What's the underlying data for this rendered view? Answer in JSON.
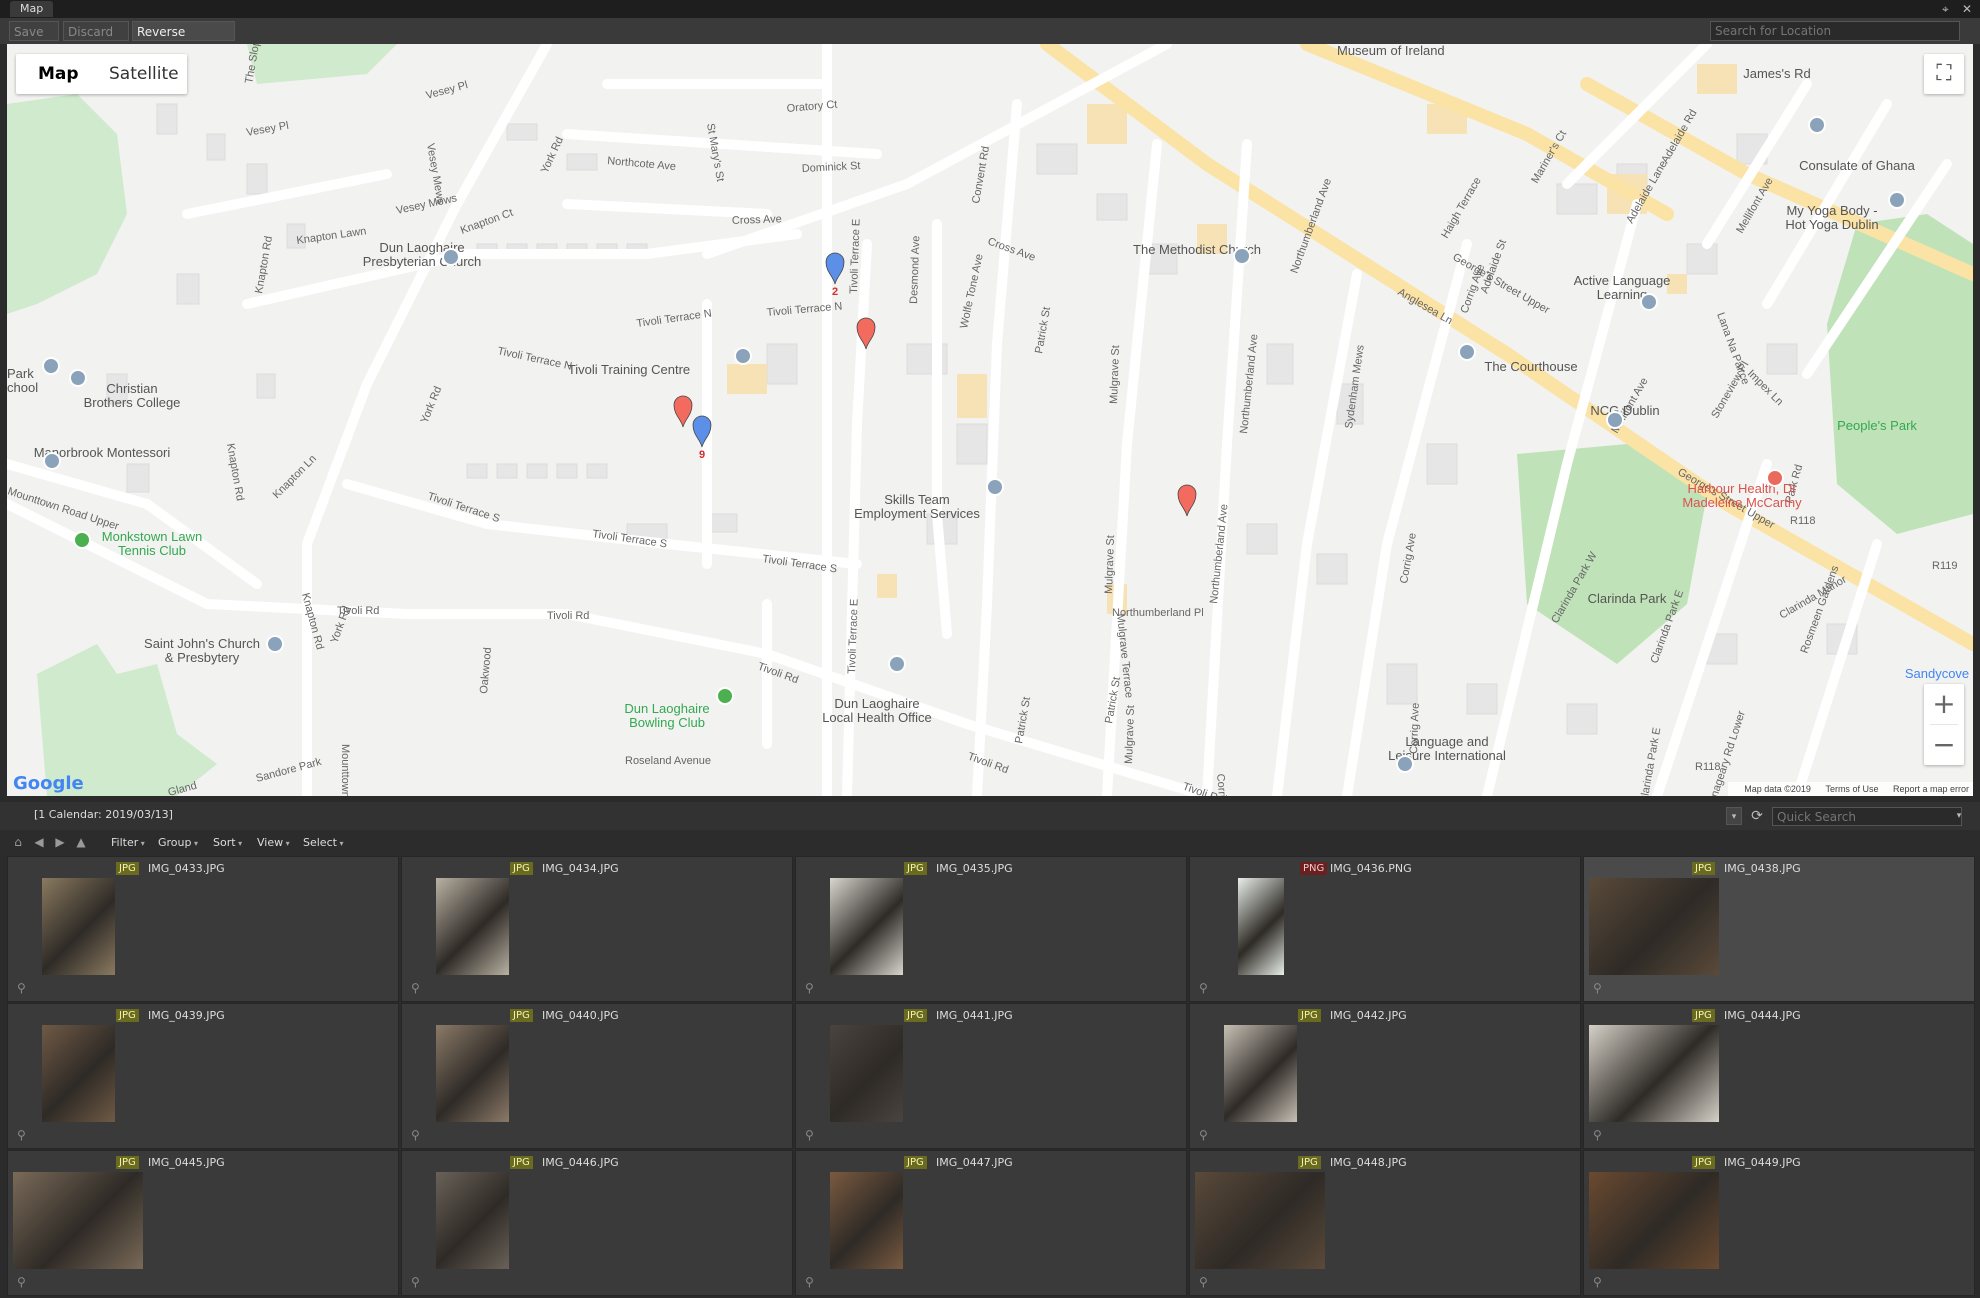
{
  "window": {
    "title": "Map",
    "pin_glyph": "⌖",
    "close_glyph": "✕"
  },
  "toolbar": {
    "save_all": "Save All",
    "discard_all": "Discard All",
    "reverse_geocode": "Reverse Geocode",
    "search_placeholder": "Search for Location"
  },
  "map": {
    "type_map": "Map",
    "type_satellite": "Satellite",
    "fullscreen_glyph": "⛶",
    "zoom_in": "+",
    "zoom_out": "−",
    "google_logo": "Google",
    "attribution": {
      "data": "Map data ©2019",
      "terms": "Terms of Use",
      "report": "Report a map error"
    },
    "labels": [
      {
        "text": "Vesey Pl"
      },
      {
        "text": "Vesey Pl"
      },
      {
        "text": "Vesey Mews"
      },
      {
        "text": "Vesey Mews"
      },
      {
        "text": "Knapton Lawn"
      },
      {
        "text": "Knapton Ct"
      },
      {
        "text": "Knapton Rd"
      },
      {
        "text": "Knapton Rd"
      },
      {
        "text": "Knapton Ln"
      },
      {
        "text": "Knapton Rd"
      },
      {
        "text": "York Rd"
      },
      {
        "text": "York Rd"
      },
      {
        "text": "York Rd"
      },
      {
        "text": "Northcote Ave"
      },
      {
        "text": "Dominick St"
      },
      {
        "text": "Oratory Ct"
      },
      {
        "text": "St Mary's St"
      },
      {
        "text": "Cross Ave"
      },
      {
        "text": "Cross Ave"
      },
      {
        "text": "Tivoli Terrace N"
      },
      {
        "text": "Tivoli Terrace N"
      },
      {
        "text": "Tivoli Terrace N"
      },
      {
        "text": "Tivoli Terrace E"
      },
      {
        "text": "Tivoli Terrace E"
      },
      {
        "text": "Tivoli Terrace S"
      },
      {
        "text": "Tivoli Terrace S"
      },
      {
        "text": "Tivoli Terrace S"
      },
      {
        "text": "Desmond Ave"
      },
      {
        "text": "Wolfe Tone Ave"
      },
      {
        "text": "Convent Rd"
      },
      {
        "text": "Patrick St"
      },
      {
        "text": "Patrick St"
      },
      {
        "text": "Patrick St"
      },
      {
        "text": "Mulgrave St"
      },
      {
        "text": "Mulgrave St"
      },
      {
        "text": "Mulgrave St"
      },
      {
        "text": "Mulgrave Terrace"
      },
      {
        "text": "Northumberland Ave"
      },
      {
        "text": "Northumberland Ave"
      },
      {
        "text": "Northumberland Ave"
      },
      {
        "text": "Northumberland Pl"
      },
      {
        "text": "Sydenham Mews"
      },
      {
        "text": "Anglesea Ln"
      },
      {
        "text": "Corrig Ave"
      },
      {
        "text": "Corrig Ave"
      },
      {
        "text": "Corrig Ave"
      },
      {
        "text": "Corrig Park"
      },
      {
        "text": "George's Street Upper"
      },
      {
        "text": "George's Street Upper"
      },
      {
        "text": "Haigh Terrace"
      },
      {
        "text": "Mariner's Ct"
      },
      {
        "text": "Adelaide St"
      },
      {
        "text": "Adelaide Lane"
      },
      {
        "text": "Adelaide Rd"
      },
      {
        "text": "Mellifont Ave"
      },
      {
        "text": "Mellifont Ave"
      },
      {
        "text": "Lana Na Pairce"
      },
      {
        "text": "Stoneview Pl"
      },
      {
        "text": "Impex Ln"
      },
      {
        "text": "Park Rd"
      },
      {
        "text": "Clarinda Park W"
      },
      {
        "text": "Clarinda Park E"
      },
      {
        "text": "Clarinda Park E"
      },
      {
        "text": "Clarinda Manor"
      },
      {
        "text": "Glenageary Rd Lower"
      },
      {
        "text": "Rosmeen Gardens"
      },
      {
        "text": "Tivoli Rd"
      },
      {
        "text": "Tivoli Rd"
      },
      {
        "text": "Tivoli Rd"
      },
      {
        "text": "Tivoli Rd"
      },
      {
        "text": "Tivoli Rd"
      },
      {
        "text": "Mounttown Lower"
      },
      {
        "text": "Mounttown Road Upper"
      },
      {
        "text": "Oakwood"
      },
      {
        "text": "Roseland Avenue"
      },
      {
        "text": "Gland"
      },
      {
        "text": "Sandore Park"
      },
      {
        "text": "The Slope"
      },
      {
        "text": "R118"
      },
      {
        "text": "R119"
      },
      {
        "text": "R118"
      }
    ],
    "pois": [
      {
        "name": "Dun Laoghaire Presbyterian Church"
      },
      {
        "name": "Tivoli Training Centre"
      },
      {
        "name": "Christian Brothers College"
      },
      {
        "name": "Park School"
      },
      {
        "name": "Manorbrook Montessori"
      },
      {
        "name": "Monkstown Lawn Tennis Club"
      },
      {
        "name": "Saint John's Church & Presbytery"
      },
      {
        "name": "Dun Laoghaire Bowling Club"
      },
      {
        "name": "Dun Laoghaire Local Health Office"
      },
      {
        "name": "Skills Team Employment Services"
      },
      {
        "name": "The Methodist Church"
      },
      {
        "name": "The Courthouse"
      },
      {
        "name": "Active Language Learning"
      },
      {
        "name": "Consulate of Ghana"
      },
      {
        "name": "My Yoga Body - Hot Yoga Dublin"
      },
      {
        "name": "NCG Dublin"
      },
      {
        "name": "People's Park"
      },
      {
        "name": "Harbour Health, Dr Madeleine McCarthy"
      },
      {
        "name": "Clarinda Park"
      },
      {
        "name": "Language and Leisure International"
      },
      {
        "name": "Sandycove"
      },
      {
        "name": "Museum of Ireland"
      },
      {
        "name": "James's Rd"
      }
    ],
    "markers": [
      {
        "color": "#5b8fe8",
        "label": "2"
      },
      {
        "color": "#f26b5e",
        "label": ""
      },
      {
        "color": "#f26b5e",
        "label": ""
      },
      {
        "color": "#5b8fe8",
        "label": "9"
      },
      {
        "color": "#f26b5e",
        "label": ""
      }
    ]
  },
  "calendar_bar": {
    "label": "[1 Calendar: 2019/03/13]",
    "quick_search_placeholder": "Quick Search"
  },
  "filter_bar": {
    "menus": [
      "Filter",
      "Group",
      "Sort",
      "View",
      "Select"
    ]
  },
  "thumbnails": [
    {
      "name": "IMG_0433.JPG",
      "type": "JPG",
      "selected": false
    },
    {
      "name": "IMG_0434.JPG",
      "type": "JPG",
      "selected": false
    },
    {
      "name": "IMG_0435.JPG",
      "type": "JPG",
      "selected": false
    },
    {
      "name": "IMG_0436.PNG",
      "type": "PNG",
      "selected": false
    },
    {
      "name": "IMG_0438.JPG",
      "type": "JPG",
      "selected": true
    },
    {
      "name": "IMG_0439.JPG",
      "type": "JPG",
      "selected": false
    },
    {
      "name": "IMG_0440.JPG",
      "type": "JPG",
      "selected": false
    },
    {
      "name": "IMG_0441.JPG",
      "type": "JPG",
      "selected": false
    },
    {
      "name": "IMG_0442.JPG",
      "type": "JPG",
      "selected": false
    },
    {
      "name": "IMG_0444.JPG",
      "type": "JPG",
      "selected": false
    },
    {
      "name": "IMG_0445.JPG",
      "type": "JPG",
      "selected": false
    },
    {
      "name": "IMG_0446.JPG",
      "type": "JPG",
      "selected": false
    },
    {
      "name": "IMG_0447.JPG",
      "type": "JPG",
      "selected": false
    },
    {
      "name": "IMG_0448.JPG",
      "type": "JPG",
      "selected": false
    },
    {
      "name": "IMG_0449.JPG",
      "type": "JPG",
      "selected": false
    }
  ]
}
